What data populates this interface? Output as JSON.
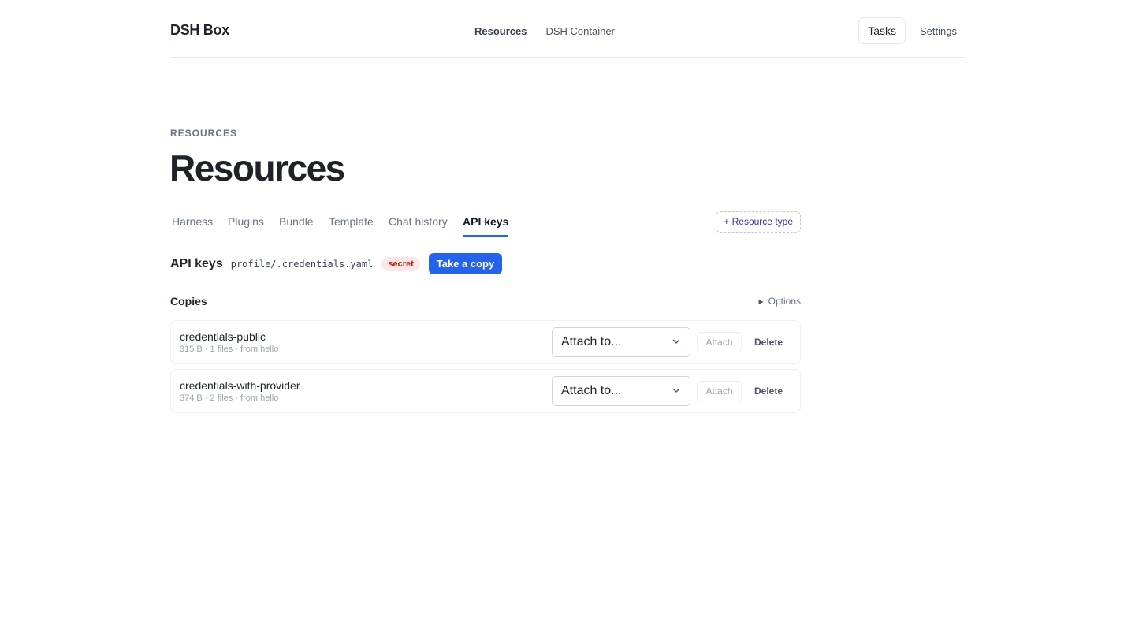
{
  "header": {
    "brand": "DSH Box",
    "nav": [
      {
        "label": "Resources"
      },
      {
        "label": "DSH Container"
      }
    ],
    "tasks_label": "Tasks",
    "settings_label": "Settings"
  },
  "page": {
    "eyebrow": "RESOURCES",
    "title": "Resources"
  },
  "tabs": [
    {
      "label": "Harness"
    },
    {
      "label": "Plugins"
    },
    {
      "label": "Bundle"
    },
    {
      "label": "Template"
    },
    {
      "label": "Chat history"
    },
    {
      "label": "API keys"
    }
  ],
  "active_tab": "API keys",
  "resource_type_label": "+ Resource type",
  "section": {
    "title": "API keys",
    "path": "profile/.credentials.yaml",
    "badge": "secret",
    "copy_button": "Take a copy"
  },
  "copies": {
    "label": "Copies",
    "options_label": "Options",
    "items": [
      {
        "name": "credentials-public",
        "meta": "315 B · 1 files · from hello",
        "select_value": "Attach to...",
        "attach_label": "Attach",
        "delete_label": "Delete"
      },
      {
        "name": "credentials-with-provider",
        "meta": "374 B · 2 files · from hello",
        "select_value": "Attach to...",
        "attach_label": "Attach",
        "delete_label": "Delete"
      }
    ]
  },
  "colors": {
    "accent": "#2563eb",
    "secret_badge_bg": "#fde8e8",
    "secret_badge_text": "#b91c1c"
  }
}
